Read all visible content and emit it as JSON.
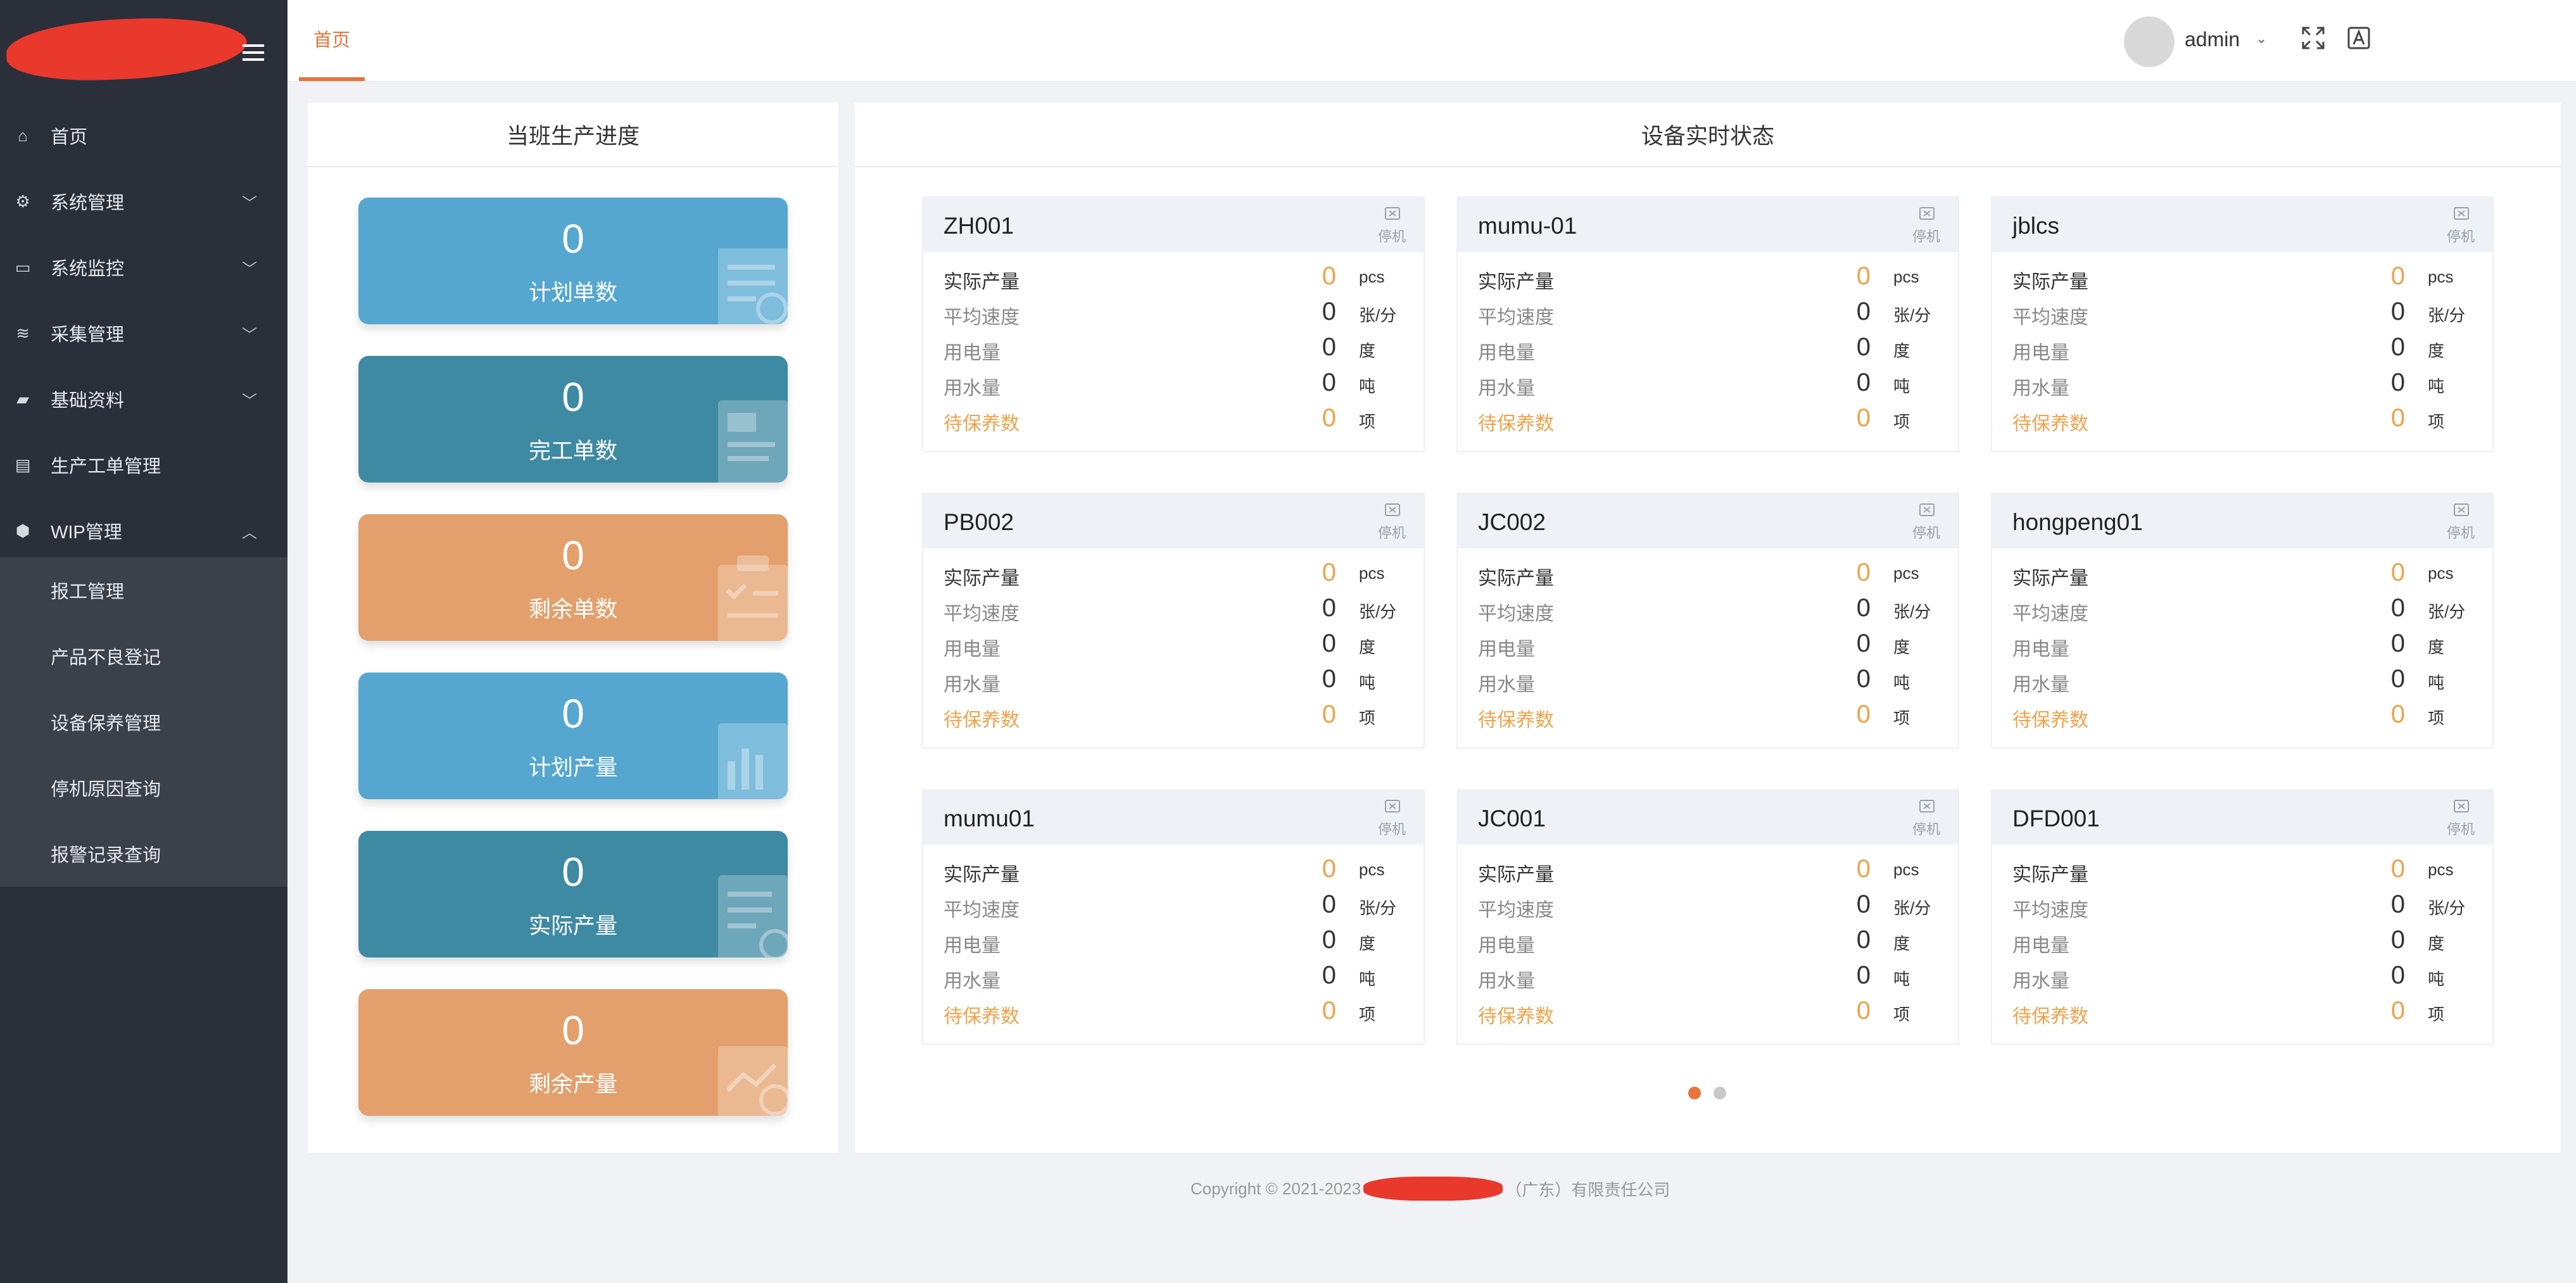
{
  "sidebar": {
    "menu": [
      {
        "label": "首页",
        "icon": "home-icon",
        "glyph": "⌂",
        "has_arrow": false
      },
      {
        "label": "系统管理",
        "icon": "gear-icon",
        "glyph": "⚙",
        "has_arrow": true
      },
      {
        "label": "系统监控",
        "icon": "monitor-icon",
        "glyph": "▭",
        "has_arrow": true
      },
      {
        "label": "采集管理",
        "icon": "layers-icon",
        "glyph": "≋",
        "has_arrow": true
      },
      {
        "label": "基础资料",
        "icon": "folder-icon",
        "glyph": "▰",
        "has_arrow": true
      },
      {
        "label": "生产工单管理",
        "icon": "document-icon",
        "glyph": "▤",
        "has_arrow": false
      },
      {
        "label": "WIP管理",
        "icon": "cube-icon",
        "glyph": "⬢",
        "has_arrow": true,
        "expanded": true
      }
    ],
    "submenu": [
      "报工管理",
      "产品不良登记",
      "设备保养管理",
      "停机原因查询",
      "报警记录查询"
    ]
  },
  "topbar": {
    "tab": "首页",
    "username": "admin",
    "colors": {
      "accent": "#e8743b"
    }
  },
  "left_panel": {
    "title": "当班生产进度",
    "cards": [
      {
        "value": "0",
        "label": "计划单数",
        "color": "blue",
        "icon": "receipt-icon"
      },
      {
        "value": "0",
        "label": "完工单数",
        "color": "teal",
        "icon": "document-icon"
      },
      {
        "value": "0",
        "label": "剩余单数",
        "color": "orange",
        "icon": "clipboard-icon"
      },
      {
        "value": "0",
        "label": "计划产量",
        "color": "blue",
        "icon": "bar-chart-icon"
      },
      {
        "value": "0",
        "label": "实际产量",
        "color": "teal",
        "icon": "report-icon"
      },
      {
        "value": "0",
        "label": "剩余产量",
        "color": "orange",
        "icon": "trend-icon"
      }
    ]
  },
  "right_panel": {
    "title": "设备实时状态",
    "status_label": "停机",
    "row_labels": [
      "实际产量",
      "平均速度",
      "用电量",
      "用水量",
      "待保养数"
    ],
    "row_units": [
      "pcs",
      "张/分",
      "度",
      "吨",
      "项"
    ],
    "devices": [
      {
        "name": "ZH001",
        "values": [
          "0",
          "0",
          "0",
          "0",
          "0"
        ]
      },
      {
        "name": "mumu-01",
        "values": [
          "0",
          "0",
          "0",
          "0",
          "0"
        ]
      },
      {
        "name": "jblcs",
        "values": [
          "0",
          "0",
          "0",
          "0",
          "0"
        ]
      },
      {
        "name": "PB002",
        "values": [
          "0",
          "0",
          "0",
          "0",
          "0"
        ]
      },
      {
        "name": "JC002",
        "values": [
          "0",
          "0",
          "0",
          "0",
          "0"
        ]
      },
      {
        "name": "hongpeng01",
        "values": [
          "0",
          "0",
          "0",
          "0",
          "0"
        ]
      },
      {
        "name": "mumu01",
        "values": [
          "0",
          "0",
          "0",
          "0",
          "0"
        ]
      },
      {
        "name": "JC001",
        "values": [
          "0",
          "0",
          "0",
          "0",
          "0"
        ]
      },
      {
        "name": "DFD001",
        "values": [
          "0",
          "0",
          "0",
          "0",
          "0"
        ]
      }
    ],
    "pagination": {
      "pages": 2,
      "current": 1
    }
  },
  "footer": {
    "prefix": "Copyright © 2021-2023",
    "suffix": "（广东）有限责任公司"
  }
}
